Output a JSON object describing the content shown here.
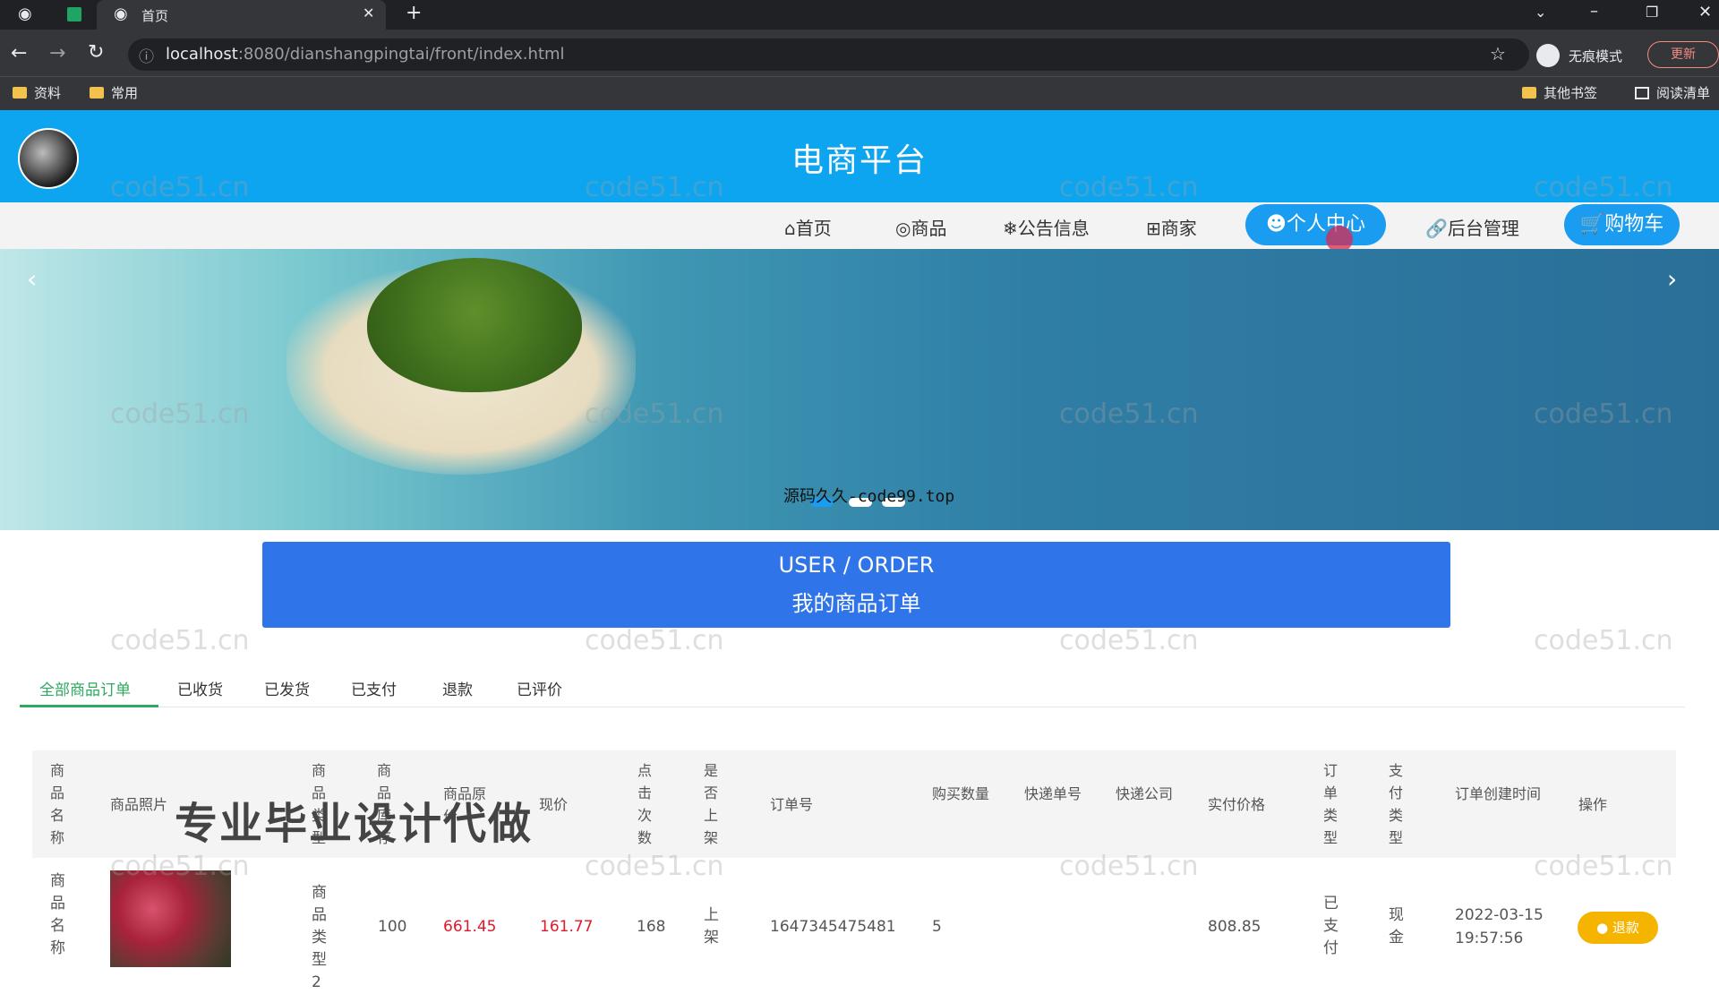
{
  "browser": {
    "tab_title": "首页",
    "url_host": "localhost",
    "url_rest": ":8080/dianshangpingtai/front/index.html",
    "incognito_label": "无痕模式",
    "update_label": "更新",
    "bookmarks": [
      "资料",
      "常用"
    ],
    "bookmarks_right": [
      "其他书签",
      "阅读清单"
    ]
  },
  "site": {
    "title": "电商平台",
    "nav": [
      "首页",
      "商品",
      "公告信息",
      "商家",
      "个人中心",
      "后台管理",
      "购物车"
    ]
  },
  "banner": {
    "watermark": "源码久久-code99.top"
  },
  "order": {
    "heading_en": "USER / ORDER",
    "heading_cn": "我的商品订单",
    "tabs": [
      "全部商品订单",
      "已收货",
      "已发货",
      "已支付",
      "退款",
      "已评价"
    ],
    "columns": [
      "商品名称",
      "商品照片",
      "商品类型",
      "商品库存",
      "商品原价",
      "现价",
      "点击次数",
      "是否上架",
      "订单号",
      "购买数量",
      "快递单号",
      "快递公司",
      "实付价格",
      "订单类型",
      "支付类型",
      "订单创建时间",
      "操作"
    ],
    "row": {
      "name": "商品名称",
      "type": "商品类型2",
      "stock": "100",
      "original_price": "661.45",
      "price": "161.77",
      "clicks": "168",
      "on_shelf": "上架",
      "order_no": "1647345475481",
      "quantity": "5",
      "paid_price": "808.85",
      "order_type": "已支付",
      "pay_type": "现金",
      "created_date": "2022-03-15",
      "created_time": "19:57:56",
      "action": "退款"
    }
  },
  "overlay_text": "专业毕业设计代做",
  "watermark": "code51.cn"
}
